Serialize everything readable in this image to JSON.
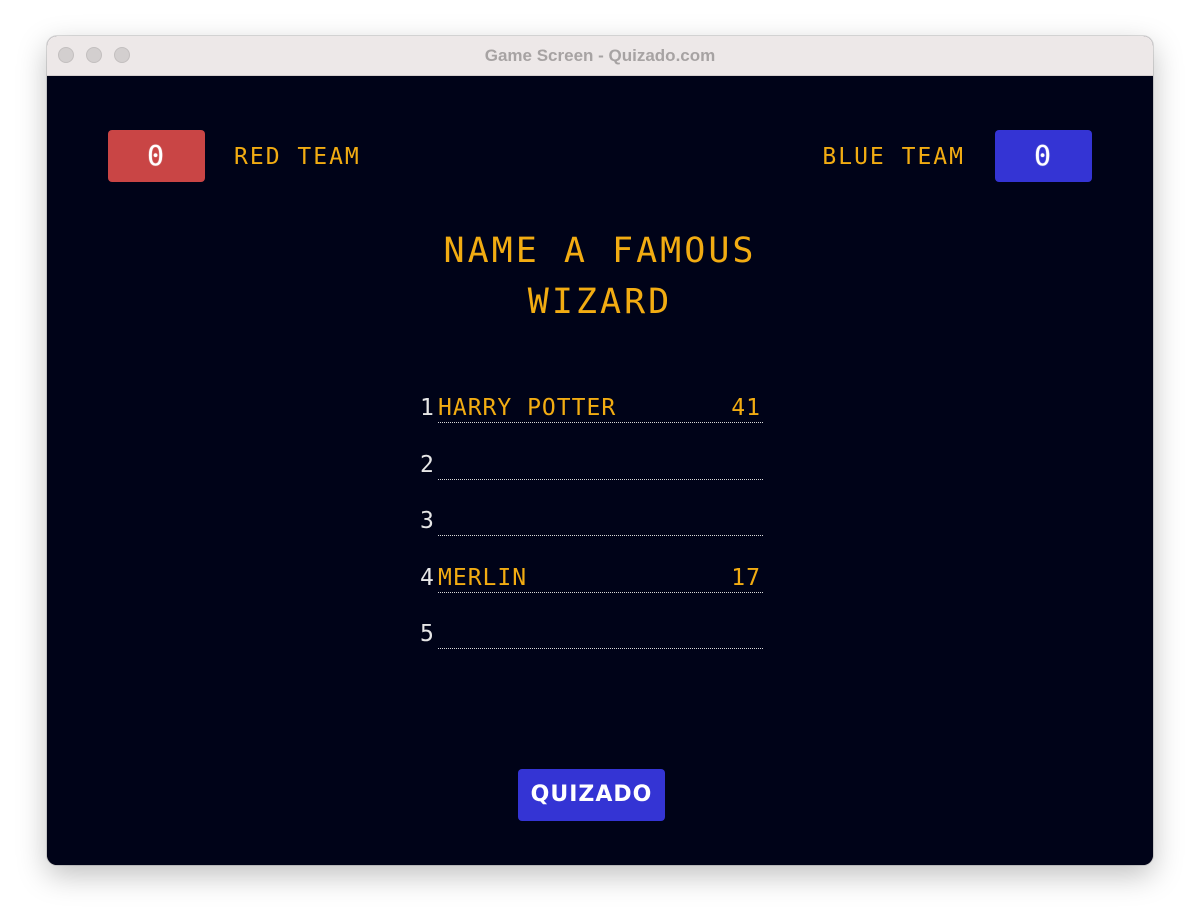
{
  "window": {
    "title": "Game Screen - Quizado.com"
  },
  "teams": {
    "red": {
      "label": "RED TEAM",
      "score": "0",
      "color": "#c94545"
    },
    "blue": {
      "label": "BLUE TEAM",
      "score": "0",
      "color": "#3434d4"
    }
  },
  "question": {
    "line1": "NAME A FAMOUS",
    "line2": "WIZARD"
  },
  "answers": [
    {
      "number": "1",
      "text": "HARRY POTTER",
      "points": "41"
    },
    {
      "number": "2",
      "text": "",
      "points": ""
    },
    {
      "number": "3",
      "text": "",
      "points": ""
    },
    {
      "number": "4",
      "text": "MERLIN",
      "points": "17"
    },
    {
      "number": "5",
      "text": "",
      "points": ""
    }
  ],
  "logo": {
    "text": "QUIZADO"
  },
  "colors": {
    "background": "#000318",
    "accent_text": "#f2ac12",
    "number_text": "#e6e6e6"
  }
}
